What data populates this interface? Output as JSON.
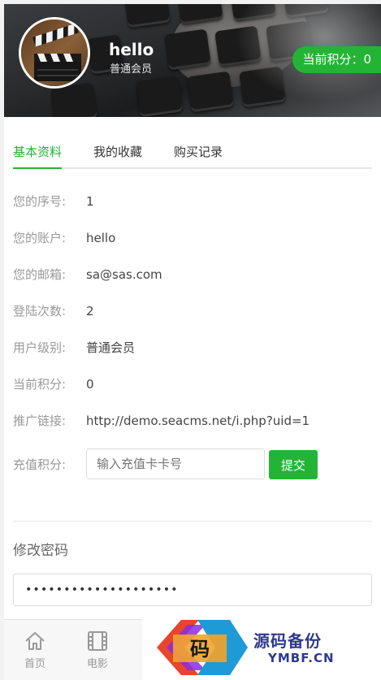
{
  "header": {
    "username": "hello",
    "user_level": "普通会员",
    "points_badge": "当前积分：0"
  },
  "tabs": [
    {
      "label": "基本资料",
      "active": true
    },
    {
      "label": "我的收藏",
      "active": false
    },
    {
      "label": "购买记录",
      "active": false
    }
  ],
  "profile": {
    "rows": [
      {
        "label": "您的序号:",
        "value": "1"
      },
      {
        "label": "您的账户:",
        "value": "hello"
      },
      {
        "label": "您的邮箱:",
        "value": "sa@sas.com"
      },
      {
        "label": "登陆次数:",
        "value": "2"
      },
      {
        "label": "用户级别:",
        "value": "普通会员"
      },
      {
        "label": "当前积分:",
        "value": "0"
      },
      {
        "label": "推广链接:",
        "value": "http://demo.seacms.net/i.php?uid=1"
      }
    ],
    "recharge": {
      "label": "充值积分:",
      "placeholder": "输入充值卡卡号",
      "button": "提交"
    }
  },
  "password": {
    "title": "修改密码",
    "value": "••••••••••••••••••••"
  },
  "bottom_nav": [
    {
      "label": "首页",
      "icon": "home-icon"
    },
    {
      "label": "电影",
      "icon": "film-icon"
    }
  ],
  "watermark": {
    "badge_char": "码",
    "title": "源码备份",
    "subtitle": "YMBF.CN"
  },
  "colors": {
    "accent": "#23b436",
    "watermark": "#2e3a8c"
  }
}
